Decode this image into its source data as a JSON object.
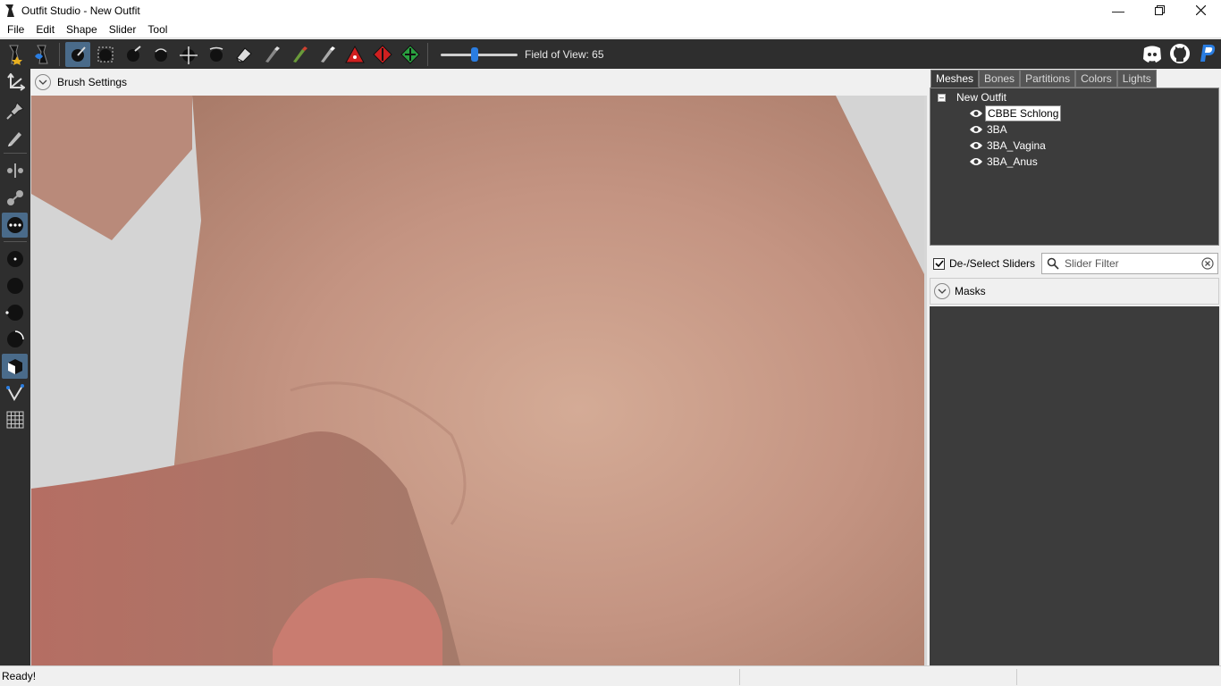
{
  "window": {
    "title": "Outfit Studio - New Outfit"
  },
  "menu": [
    "File",
    "Edit",
    "Shape",
    "Slider",
    "Tool"
  ],
  "toolbar": {
    "fov_label": "Field of View: 65",
    "fov_slider_fraction": 0.4
  },
  "viewport": {
    "brush_settings_label": "Brush Settings"
  },
  "right_panel": {
    "tabs": [
      "Meshes",
      "Bones",
      "Partitions",
      "Colors",
      "Lights"
    ],
    "active_tab": "Meshes",
    "tree": {
      "root": "New Outfit",
      "meshes": [
        "CBBE Schlong",
        "3BA",
        "3BA_Vagina",
        "3BA_Anus"
      ],
      "selected": "CBBE Schlong"
    },
    "deselect_sliders_label": "De-/Select Sliders",
    "slider_filter_placeholder": "Slider Filter",
    "masks_label": "Masks"
  },
  "status": {
    "text": "Ready!"
  },
  "colors": {
    "toolbar_bg": "#2e2e2e",
    "panel_dark": "#3c3c3c",
    "active_tool": "#4a6b8a",
    "accent_blue": "#2a7de1"
  }
}
